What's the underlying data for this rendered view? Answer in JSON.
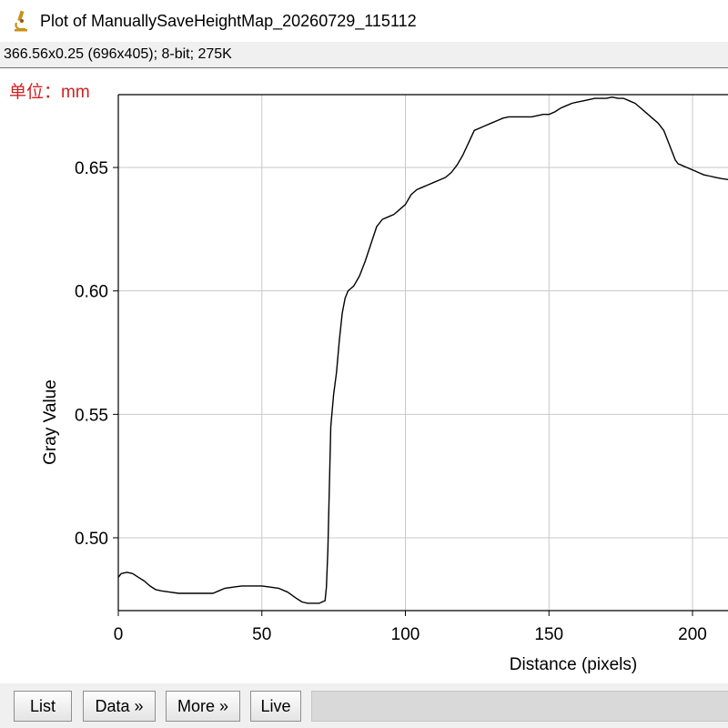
{
  "window": {
    "title": "Plot of ManuallySaveHeightMap_20260729_115112",
    "icon": "microscope-icon"
  },
  "image_info": "366.56x0.25   (696x405); 8-bit; 275K",
  "plot": {
    "unit_label": "单位：mm"
  },
  "buttons": {
    "list": "List",
    "data": "Data »",
    "more": "More »",
    "live": "Live"
  },
  "chart_data": {
    "type": "line",
    "title": "",
    "xlabel": "Distance (pixels)",
    "ylabel": "Gray Value",
    "xlim": [
      0,
      213
    ],
    "ylim": [
      0.4705,
      0.6795
    ],
    "xticks": [
      0,
      50,
      100,
      150,
      200
    ],
    "yticks": [
      0.5,
      0.55,
      0.6,
      0.65
    ],
    "ytick_labels": [
      "0.50",
      "0.55",
      "0.60",
      "0.65"
    ],
    "grid": true,
    "line_color": "#000000",
    "grid_color": "#c8c8c8",
    "unit_color": "#d42020",
    "series": [
      {
        "x": [
          0,
          1,
          3,
          5,
          7,
          9,
          11,
          13,
          15,
          18,
          21,
          24,
          27,
          30,
          33,
          35,
          37,
          40,
          43,
          46,
          50,
          53,
          56,
          59,
          62,
          64,
          66,
          68,
          70,
          71,
          72,
          72.5,
          73,
          73.5,
          74,
          75,
          76,
          77,
          78,
          79,
          80,
          81,
          82,
          84,
          86,
          88,
          90,
          92,
          94,
          96,
          98,
          100,
          102,
          104,
          106,
          108,
          110,
          112,
          114,
          116,
          118,
          120,
          122,
          124,
          126,
          128,
          130,
          132,
          134,
          136,
          138,
          140,
          142,
          144,
          146,
          148,
          150,
          152,
          154,
          156,
          158,
          160,
          162,
          164,
          166,
          168,
          170,
          172,
          174,
          176,
          178,
          180,
          182,
          184,
          186,
          188,
          190,
          192,
          194,
          195,
          196,
          197,
          198,
          199,
          200,
          202,
          204,
          206,
          208,
          210,
          213
        ],
        "y": [
          0.484,
          0.4855,
          0.486,
          0.4855,
          0.484,
          0.4825,
          0.4805,
          0.479,
          0.4785,
          0.478,
          0.4775,
          0.4775,
          0.4775,
          0.4775,
          0.4775,
          0.4785,
          0.4795,
          0.48,
          0.4805,
          0.4805,
          0.4805,
          0.48,
          0.4795,
          0.478,
          0.4755,
          0.474,
          0.4735,
          0.4735,
          0.4735,
          0.474,
          0.4745,
          0.48,
          0.495,
          0.52,
          0.545,
          0.558,
          0.567,
          0.58,
          0.591,
          0.597,
          0.6,
          0.601,
          0.602,
          0.606,
          0.612,
          0.619,
          0.626,
          0.629,
          0.63,
          0.631,
          0.633,
          0.635,
          0.639,
          0.641,
          0.642,
          0.643,
          0.644,
          0.645,
          0.646,
          0.648,
          0.651,
          0.655,
          0.66,
          0.665,
          0.666,
          0.667,
          0.668,
          0.669,
          0.67,
          0.6705,
          0.6705,
          0.6705,
          0.6705,
          0.6705,
          0.671,
          0.6715,
          0.6715,
          0.6725,
          0.674,
          0.675,
          0.676,
          0.6765,
          0.677,
          0.6775,
          0.678,
          0.678,
          0.678,
          0.6785,
          0.678,
          0.678,
          0.677,
          0.676,
          0.674,
          0.672,
          0.67,
          0.668,
          0.665,
          0.659,
          0.653,
          0.6515,
          0.651,
          0.6505,
          0.65,
          0.6495,
          0.649,
          0.648,
          0.647,
          0.6465,
          0.646,
          0.6455,
          0.645
        ]
      }
    ]
  }
}
